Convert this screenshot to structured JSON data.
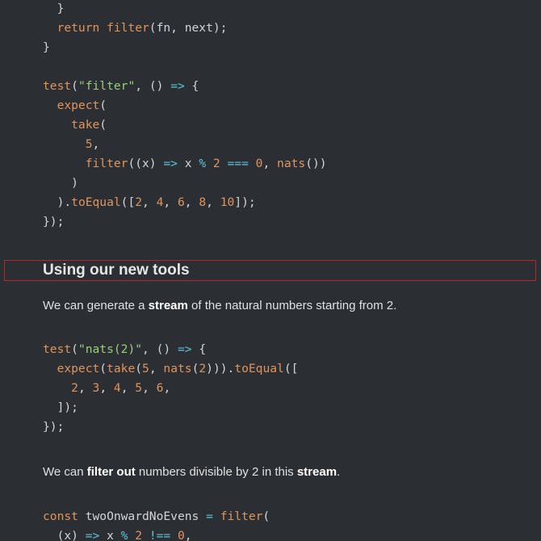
{
  "code_blocks": [
    {
      "lines": [
        [
          [
            "tk-punct",
            "  }"
          ]
        ],
        [
          [
            "tk-kw",
            "  return "
          ],
          [
            "tk-fn",
            "filter"
          ],
          [
            "tk-punct",
            "(fn, next);"
          ]
        ],
        [
          [
            "tk-punct",
            "}"
          ]
        ],
        [],
        [
          [
            "tk-fn",
            "test"
          ],
          [
            "tk-punct",
            "("
          ],
          [
            "tk-str",
            "\"filter\""
          ],
          [
            "tk-punct",
            ", () "
          ],
          [
            "tk-op",
            "=>"
          ],
          [
            "tk-punct",
            " {"
          ]
        ],
        [
          [
            "tk-fn",
            "  expect"
          ],
          [
            "tk-punct",
            "("
          ]
        ],
        [
          [
            "tk-fn",
            "    take"
          ],
          [
            "tk-punct",
            "("
          ]
        ],
        [
          [
            "tk-num",
            "      5"
          ],
          [
            "tk-punct",
            ","
          ]
        ],
        [
          [
            "tk-fn",
            "      filter"
          ],
          [
            "tk-punct",
            "((x) "
          ],
          [
            "tk-op",
            "=>"
          ],
          [
            "tk-punct",
            " x "
          ],
          [
            "tk-op",
            "%"
          ],
          [
            "tk-punct",
            " "
          ],
          [
            "tk-num",
            "2"
          ],
          [
            "tk-punct",
            " "
          ],
          [
            "tk-op",
            "==="
          ],
          [
            "tk-punct",
            " "
          ],
          [
            "tk-num",
            "0"
          ],
          [
            "tk-punct",
            ", "
          ],
          [
            "tk-fn",
            "nats"
          ],
          [
            "tk-punct",
            "())"
          ]
        ],
        [
          [
            "tk-punct",
            "    )"
          ]
        ],
        [
          [
            "tk-punct",
            "  )."
          ],
          [
            "tk-fn",
            "toEqual"
          ],
          [
            "tk-punct",
            "(["
          ],
          [
            "tk-num",
            "2"
          ],
          [
            "tk-punct",
            ", "
          ],
          [
            "tk-num",
            "4"
          ],
          [
            "tk-punct",
            ", "
          ],
          [
            "tk-num",
            "6"
          ],
          [
            "tk-punct",
            ", "
          ],
          [
            "tk-num",
            "8"
          ],
          [
            "tk-punct",
            ", "
          ],
          [
            "tk-num",
            "10"
          ],
          [
            "tk-punct",
            "]);"
          ]
        ],
        [
          [
            "tk-punct",
            "});"
          ]
        ]
      ]
    },
    {
      "lines": [
        [
          [
            "tk-fn",
            "test"
          ],
          [
            "tk-punct",
            "("
          ],
          [
            "tk-str",
            "\"nats(2)\""
          ],
          [
            "tk-punct",
            ", () "
          ],
          [
            "tk-op",
            "=>"
          ],
          [
            "tk-punct",
            " {"
          ]
        ],
        [
          [
            "tk-fn",
            "  expect"
          ],
          [
            "tk-punct",
            "("
          ],
          [
            "tk-fn",
            "take"
          ],
          [
            "tk-punct",
            "("
          ],
          [
            "tk-num",
            "5"
          ],
          [
            "tk-punct",
            ", "
          ],
          [
            "tk-fn",
            "nats"
          ],
          [
            "tk-punct",
            "("
          ],
          [
            "tk-num",
            "2"
          ],
          [
            "tk-punct",
            ")))."
          ],
          [
            "tk-fn",
            "toEqual"
          ],
          [
            "tk-punct",
            "(["
          ]
        ],
        [
          [
            "tk-punct",
            "    "
          ],
          [
            "tk-num",
            "2"
          ],
          [
            "tk-punct",
            ", "
          ],
          [
            "tk-num",
            "3"
          ],
          [
            "tk-punct",
            ", "
          ],
          [
            "tk-num",
            "4"
          ],
          [
            "tk-punct",
            ", "
          ],
          [
            "tk-num",
            "5"
          ],
          [
            "tk-punct",
            ", "
          ],
          [
            "tk-num",
            "6"
          ],
          [
            "tk-punct",
            ","
          ]
        ],
        [
          [
            "tk-punct",
            "  ]);"
          ]
        ],
        [
          [
            "tk-punct",
            "});"
          ]
        ]
      ]
    },
    {
      "lines": [
        [
          [
            "tk-kw",
            "const "
          ],
          [
            "tk-plain",
            "twoOnwardNoEvens "
          ],
          [
            "tk-op",
            "="
          ],
          [
            "tk-punct",
            " "
          ],
          [
            "tk-fn",
            "filter"
          ],
          [
            "tk-punct",
            "("
          ]
        ],
        [
          [
            "tk-punct",
            "  (x) "
          ],
          [
            "tk-op",
            "=>"
          ],
          [
            "tk-punct",
            " x "
          ],
          [
            "tk-op",
            "%"
          ],
          [
            "tk-punct",
            " "
          ],
          [
            "tk-num",
            "2"
          ],
          [
            "tk-punct",
            " "
          ],
          [
            "tk-op",
            "!=="
          ],
          [
            "tk-punct",
            " "
          ],
          [
            "tk-num",
            "0"
          ],
          [
            "tk-punct",
            ","
          ]
        ]
      ]
    }
  ],
  "section": {
    "heading": "Using our new tools"
  },
  "paragraphs": [
    {
      "parts": [
        [
          "text",
          "We can generate a "
        ],
        [
          "strong",
          "stream"
        ],
        [
          "text",
          " of the natural numbers starting from 2."
        ]
      ]
    },
    {
      "parts": [
        [
          "text",
          "We can "
        ],
        [
          "strong",
          "filter out"
        ],
        [
          "text",
          " numbers divisible by 2 in this "
        ],
        [
          "strong",
          "stream"
        ],
        [
          "text",
          "."
        ]
      ]
    }
  ]
}
